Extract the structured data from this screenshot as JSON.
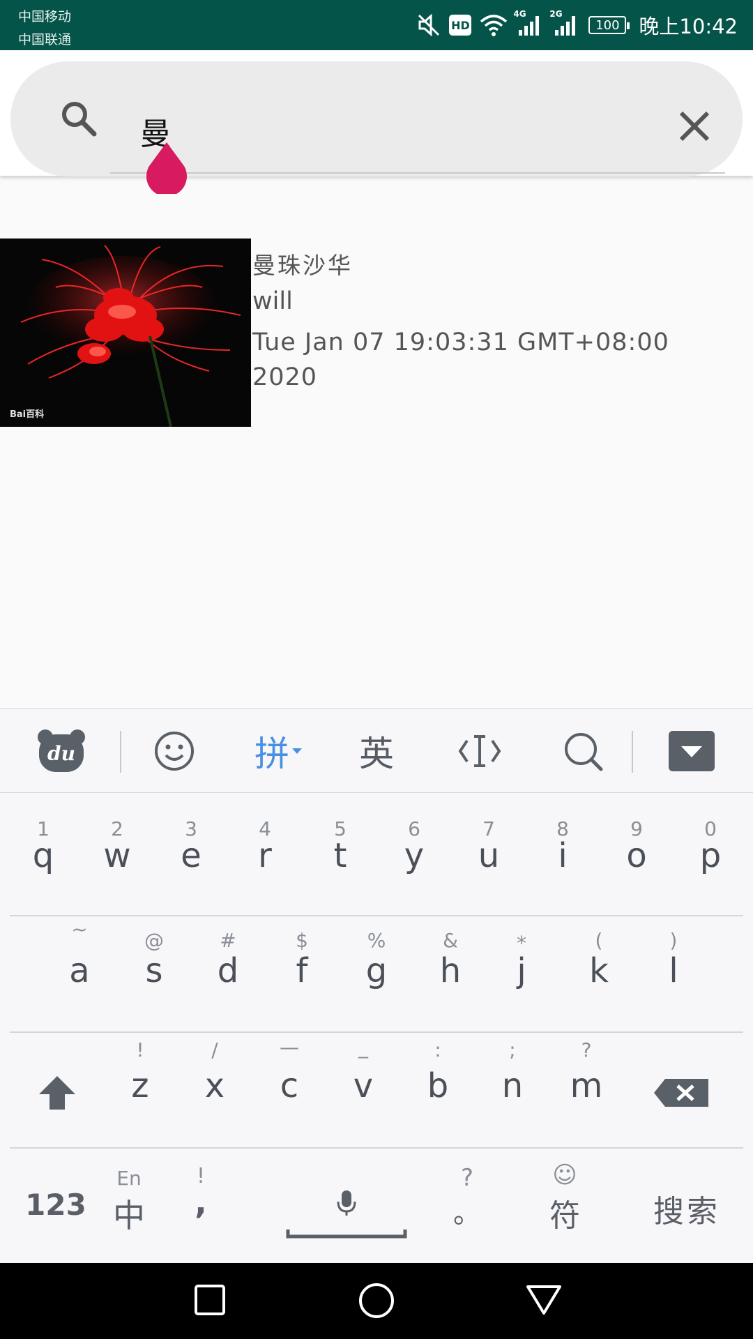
{
  "status_bar": {
    "carrier_1": "中国移动",
    "carrier_2": "中国联通",
    "hd_badge": "HD",
    "network_1": "4G",
    "network_2": "2G",
    "battery": "100",
    "time": "晚上10:42",
    "icons": [
      "mute-icon",
      "wifi-icon",
      "signal-icon",
      "battery-icon"
    ]
  },
  "search": {
    "query": "曼",
    "icons": [
      "search-icon",
      "close-icon"
    ]
  },
  "results": [
    {
      "title": "曼珠沙华",
      "author": "will",
      "date": "Tue Jan 07 19:03:31 GMT+08:00 2020",
      "thumb_watermark": "Bai百科"
    }
  ],
  "keyboard": {
    "toolbar": {
      "pinyin": "拼",
      "english": "英",
      "icons": [
        "du-logo-icon",
        "emoji-icon",
        "cursor-move-icon",
        "search-icon",
        "hide-keyboard-icon"
      ]
    },
    "row1": [
      {
        "hint": "1",
        "key": "q"
      },
      {
        "hint": "2",
        "key": "w"
      },
      {
        "hint": "3",
        "key": "e"
      },
      {
        "hint": "4",
        "key": "r"
      },
      {
        "hint": "5",
        "key": "t"
      },
      {
        "hint": "6",
        "key": "y"
      },
      {
        "hint": "7",
        "key": "u"
      },
      {
        "hint": "8",
        "key": "i"
      },
      {
        "hint": "9",
        "key": "o"
      },
      {
        "hint": "0",
        "key": "p"
      }
    ],
    "row2": [
      {
        "hint": "~",
        "key": "a"
      },
      {
        "hint": "@",
        "key": "s"
      },
      {
        "hint": "#",
        "key": "d"
      },
      {
        "hint": "$",
        "key": "f"
      },
      {
        "hint": "%",
        "key": "g"
      },
      {
        "hint": "&",
        "key": "h"
      },
      {
        "hint": "*",
        "key": "j"
      },
      {
        "hint": "(",
        "key": "k"
      },
      {
        "hint": ")",
        "key": "l"
      }
    ],
    "row3": [
      {
        "hint": "!",
        "key": "z"
      },
      {
        "hint": "/",
        "key": "x"
      },
      {
        "hint": "—",
        "key": "c"
      },
      {
        "hint": "_",
        "key": "v"
      },
      {
        "hint": ":",
        "key": "b"
      },
      {
        "hint": ";",
        "key": "n"
      },
      {
        "hint": "?",
        "key": "m"
      }
    ],
    "bottom": {
      "numbers": "123",
      "lang_hint": "En",
      "lang": "中",
      "comma_hint": "!",
      "comma": ",",
      "period_hint": "?",
      "period": "。",
      "symbols_hint": "☺",
      "symbols": "符",
      "search": "搜索"
    },
    "colors": {
      "active": "#4a90e2",
      "key_text": "#4b4f58"
    }
  },
  "nav_bar": {
    "icons": [
      "recents-square-icon",
      "home-circle-icon",
      "back-triangle-icon"
    ]
  }
}
